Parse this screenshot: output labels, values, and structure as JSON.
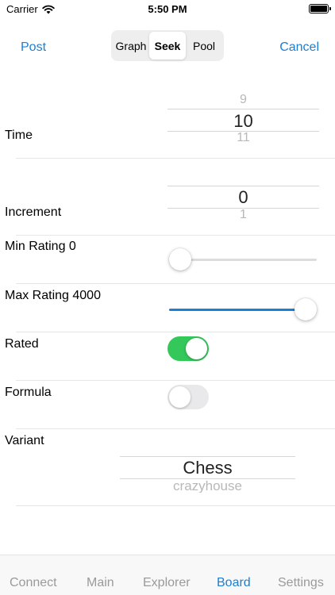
{
  "status_bar": {
    "carrier": "Carrier",
    "time": "5:50 PM"
  },
  "nav": {
    "left_label": "Post",
    "right_label": "Cancel",
    "segments": [
      {
        "label": "Graph",
        "active": false
      },
      {
        "label": "Seek",
        "active": true
      },
      {
        "label": "Pool",
        "active": false
      }
    ]
  },
  "form": {
    "time": {
      "label": "Time",
      "prev": "9",
      "selected": "10",
      "next": "11"
    },
    "increment": {
      "label": "Increment",
      "selected": "0",
      "next": "1"
    },
    "min_rating": {
      "label": "Min Rating 0",
      "value_fraction": 0.0
    },
    "max_rating": {
      "label": "Max Rating 4000",
      "value_fraction": 1.0
    },
    "rated": {
      "label": "Rated",
      "on": true
    },
    "formula": {
      "label": "Formula",
      "on": false
    },
    "variant": {
      "label": "Variant",
      "selected": "Chess",
      "next": "crazyhouse"
    }
  },
  "colors": {
    "accent": "#1a7fd6",
    "switch_on": "#34c759",
    "switch_off": "#e9e9eb"
  },
  "tabs": [
    {
      "label": "Connect",
      "active": false
    },
    {
      "label": "Main",
      "active": false
    },
    {
      "label": "Explorer",
      "active": false
    },
    {
      "label": "Board",
      "active": true
    },
    {
      "label": "Settings",
      "active": false
    }
  ]
}
